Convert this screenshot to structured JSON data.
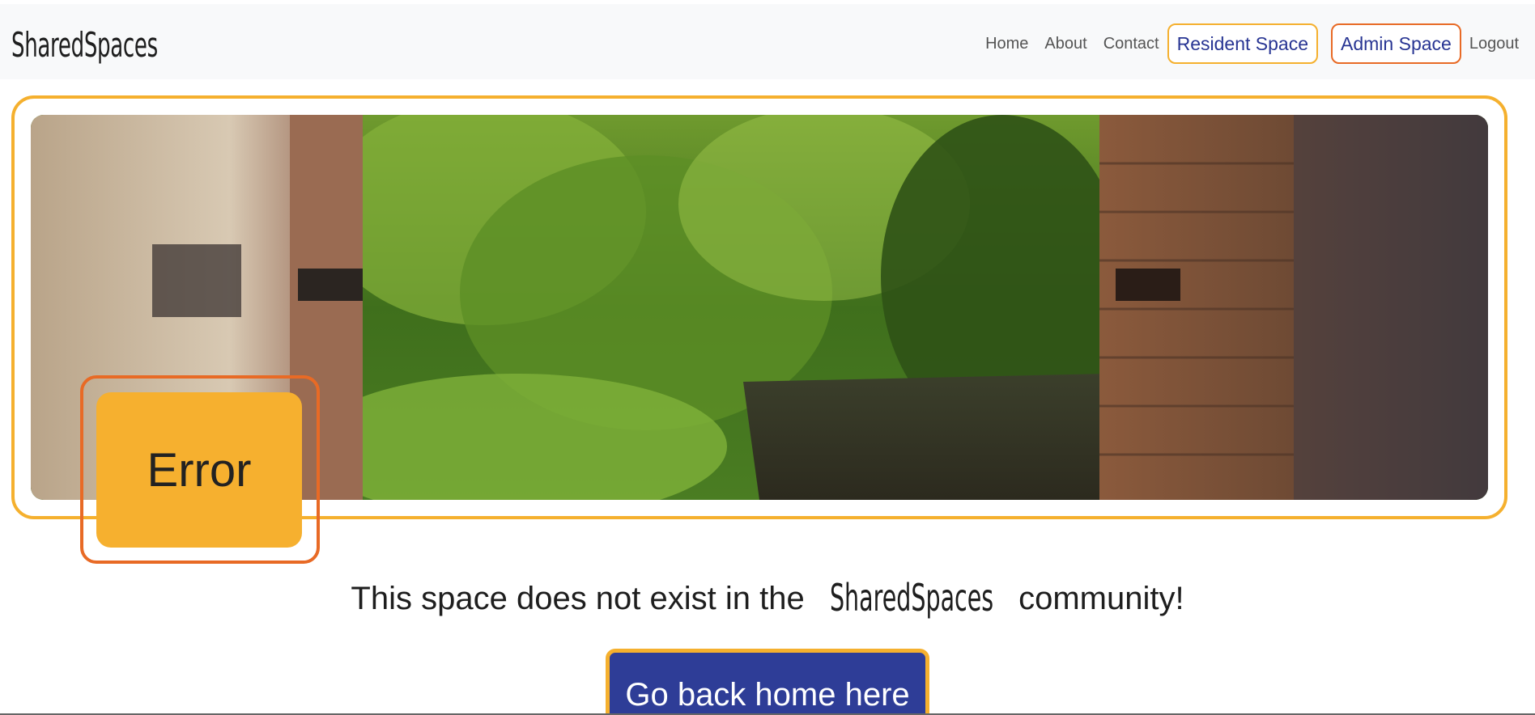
{
  "navbar": {
    "brand": "SharedSpaces",
    "links": {
      "home": "Home",
      "about": "About",
      "contact": "Contact",
      "resident_space": "Resident Space",
      "admin_space": "Admin Space",
      "logout": "Logout"
    }
  },
  "hero": {
    "badge_text": "Error",
    "image_subject": "river and trees seen through a ruined brick building"
  },
  "message": {
    "prefix": "This space does not exist in the",
    "brand": "SharedSpaces",
    "suffix": "community!"
  },
  "cta": {
    "label": "Go back home here"
  },
  "colors": {
    "accent_yellow": "#f5b02e",
    "accent_orange": "#e86a25",
    "primary_blue": "#2e3d97",
    "navbar_bg": "#f8f9fa"
  }
}
